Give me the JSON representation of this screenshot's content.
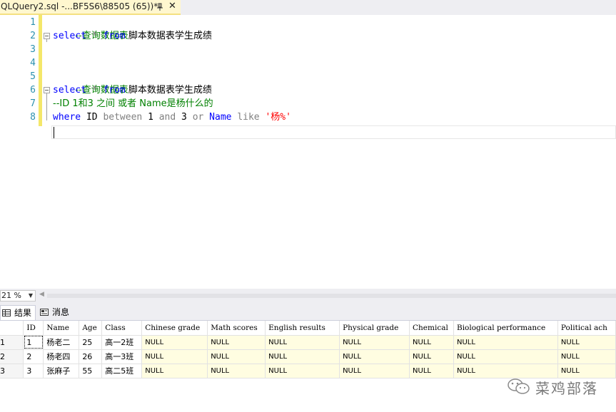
{
  "tab": {
    "title": "QLQuery2.sql -...BF5S6\\88505 (65))*"
  },
  "editor": {
    "line_numbers": [
      "1",
      "2",
      "3",
      "4",
      "5",
      "6",
      "7",
      "8"
    ],
    "l1_comment": "--查询数据表",
    "l2_kw1": "select",
    "l2_star": " * ",
    "l2_kw2": "from",
    "l2_table": " 脚本数据表学生成绩",
    "l4_comment": "--查询数据表",
    "l5_kw1": "select",
    "l5_star": " * ",
    "l5_kw2": "from",
    "l5_table": " 脚本数据表学生成绩",
    "l6_comment": "--ID 1和3 之间 或者 Name是杨什么的",
    "l7_where": "where",
    "l7_id": " ID ",
    "l7_between": "between",
    "l7_one": " 1 ",
    "l7_and": "and",
    "l7_three": " 3 ",
    "l7_or": "or",
    "l7_name": " Name ",
    "l7_like": "like",
    "l7_str": " '杨%'"
  },
  "zoom": {
    "value": "21 %"
  },
  "results_tabs": {
    "results": "结果",
    "messages": "消息"
  },
  "grid": {
    "columns": [
      "ID",
      "Name",
      "Age",
      "Class",
      "Chinese grade",
      "Math scores",
      "English results",
      "Physical grade",
      "Chemical",
      "Biological performance",
      "Political ach"
    ],
    "rows": [
      {
        "num": "1",
        "cells": [
          "1",
          "杨老二",
          "25",
          "高一2班",
          "NULL",
          "NULL",
          "NULL",
          "NULL",
          "NULL",
          "NULL",
          "NULL"
        ]
      },
      {
        "num": "2",
        "cells": [
          "2",
          "杨老四",
          "26",
          "高一3班",
          "NULL",
          "NULL",
          "NULL",
          "NULL",
          "NULL",
          "NULL",
          "NULL"
        ]
      },
      {
        "num": "3",
        "cells": [
          "3",
          "张麻子",
          "55",
          "高二5班",
          "NULL",
          "NULL",
          "NULL",
          "NULL",
          "NULL",
          "NULL",
          "NULL"
        ]
      }
    ]
  },
  "watermark": {
    "text": "菜鸡部落"
  },
  "colors": {
    "keyword": "#0000ff",
    "comment": "#008000",
    "string": "#ff0000",
    "null_bg": "#fffde1",
    "change_bar": "#f4e76a"
  }
}
